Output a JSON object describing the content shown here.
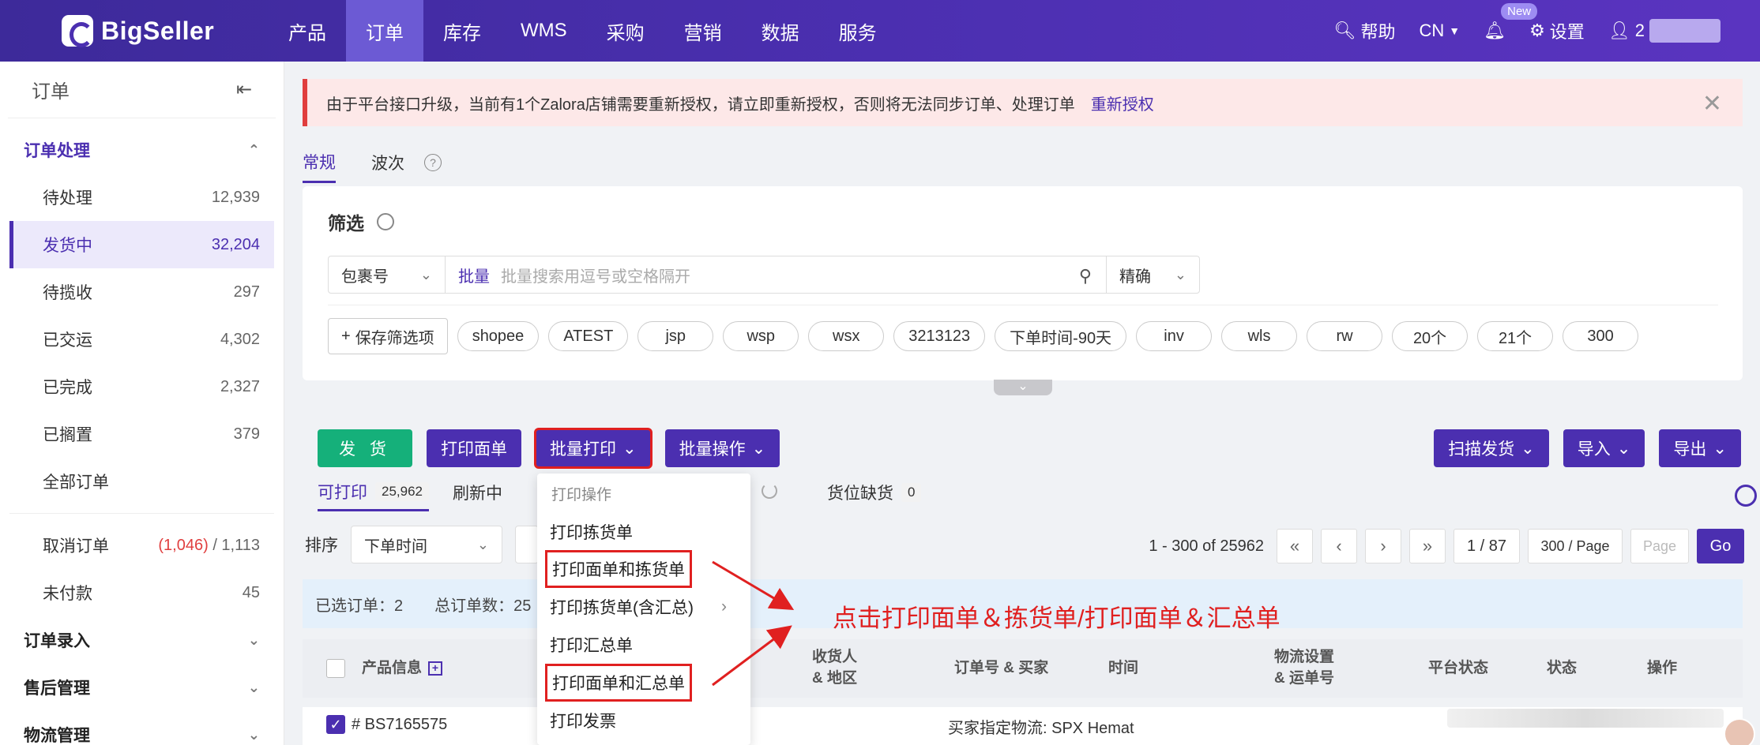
{
  "brand": {
    "name": "BigSeller"
  },
  "nav": {
    "items": [
      "产品",
      "订单",
      "库存",
      "WMS",
      "采购",
      "营销",
      "数据",
      "服务"
    ],
    "active_index": 1
  },
  "top_right": {
    "help": "帮助",
    "lang": "CN",
    "new_badge": "New",
    "settings": "设置",
    "user_initial": "2"
  },
  "sidebar": {
    "title": "订单",
    "group_order": "订单处理",
    "items": [
      {
        "label": "待处理",
        "count": "12,939"
      },
      {
        "label": "发货中",
        "count": "32,204"
      },
      {
        "label": "待揽收",
        "count": "297"
      },
      {
        "label": "已交运",
        "count": "4,302"
      },
      {
        "label": "已完成",
        "count": "2,327"
      },
      {
        "label": "已搁置",
        "count": "379"
      },
      {
        "label": "全部订单",
        "count": ""
      }
    ],
    "cancel": {
      "label": "取消订单",
      "red": "(1,046)",
      "total": " / 1,113"
    },
    "unpaid": {
      "label": "未付款",
      "count": "45"
    },
    "groups": [
      "订单录入",
      "售后管理",
      "物流管理"
    ]
  },
  "alert": {
    "text": "由于平台接口升级，当前有1个Zalora店铺需要重新授权，请立即重新授权，否则将无法同步订单、处理订单",
    "link": "重新授权"
  },
  "tabs": {
    "regular": "常规",
    "wave": "波次"
  },
  "filter": {
    "title": "筛选",
    "field": "包裹号",
    "batch": "批量",
    "placeholder": "批量搜索用逗号或空格隔开",
    "mode": "精确",
    "save": "保存筛选项",
    "chips": [
      "shopee",
      "ATEST",
      "jsp",
      "wsp",
      "wsx",
      "3213123",
      "下单时间-90天",
      "inv",
      "wls",
      "rw",
      "20个",
      "21个",
      "300"
    ]
  },
  "actions": {
    "ship": "发 货",
    "print_label": "打印面单",
    "batch_print": "批量打印",
    "batch_ops": "批量操作",
    "scan_ship": "扫描发货",
    "import": "导入",
    "export": "导出"
  },
  "subtabs": {
    "printable": "可打印",
    "printable_count": "25,962",
    "refreshing": "刷新中",
    "out_of_stock": "货位缺货",
    "out_of_stock_count": "0"
  },
  "sort": {
    "label": "排序",
    "value": "下单时间"
  },
  "pager": {
    "range": "1 - 300 of 25962",
    "page": "1 / 87",
    "size": "300 / Page",
    "page_placeholder": "Page",
    "go": "Go"
  },
  "selected": {
    "selected_label": "已选订单：2",
    "total_label": "总订单数：25"
  },
  "table": {
    "headers": {
      "product": "产品信息",
      "receiver": "收货人\n& 地区",
      "order_no": "订单号 & 买家",
      "time": "时间",
      "logistics": "物流设置\n& 运单号",
      "platform_status": "平台状态",
      "status": "状态",
      "ops": "操作"
    },
    "row": {
      "package": "# BS7165575",
      "logistics": "买家指定物流: SPX Hemat"
    }
  },
  "dropdown": {
    "header": "打印操作",
    "items": [
      "打印拣货单",
      "打印面单和拣货单",
      "打印拣货单(含汇总)",
      "打印汇总单",
      "打印面单和汇总单",
      "打印发票"
    ]
  },
  "callout": {
    "text": "点击打印面单＆拣货单/打印面单＆汇总单"
  },
  "colors": {
    "primary": "#4b2fb0",
    "success": "#15b07a",
    "danger": "#e02020"
  }
}
